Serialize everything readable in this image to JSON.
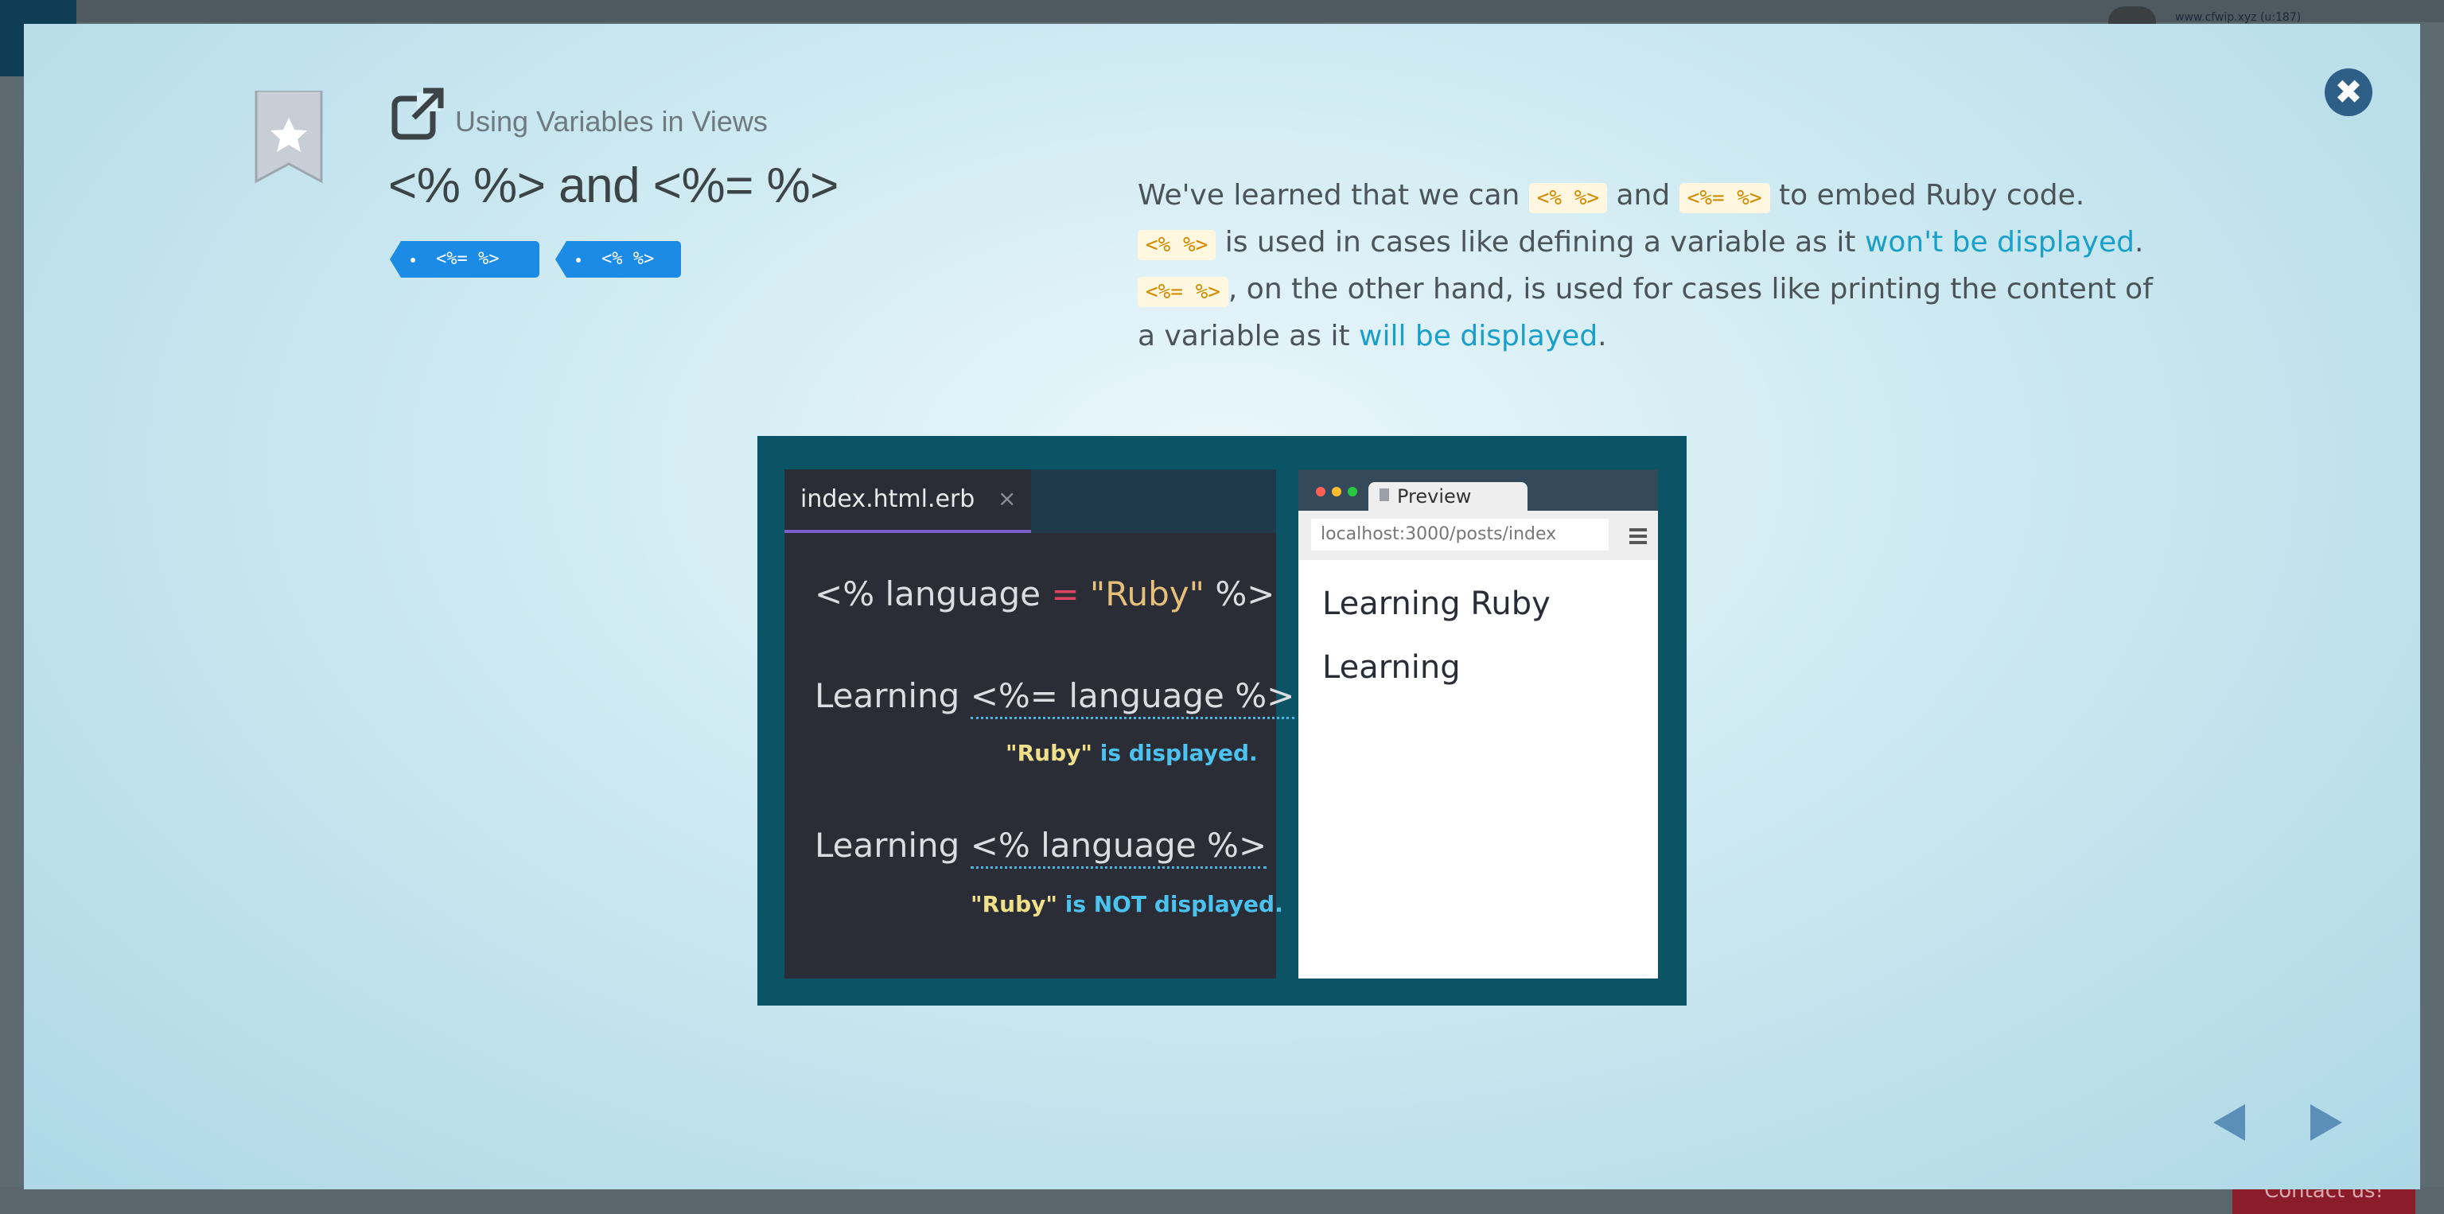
{
  "background": {
    "user_text": "www.cfwip.xyz (u:187)",
    "contact_label": "Contact us!"
  },
  "modal": {
    "close_icon": "close-icon",
    "lesson_title": "Using Variables in Views",
    "slide_title": "<% %> and <%= %>",
    "tags": [
      {
        "label": "<%= %>"
      },
      {
        "label": "<% %>"
      }
    ],
    "description": {
      "p1_a": "We've learned that we can ",
      "p1_code1": "<% %>",
      "p1_b": " and ",
      "p1_code2": "<%= %>",
      "p1_c": " to embed Ruby code.",
      "p2_code": "<% %>",
      "p2_a": " is used in cases like defining a variable as it ",
      "p2_link": "won't be displayed",
      "p2_b": ".",
      "p3_code": "<%= %>",
      "p3_a": ", on the other hand, is used for cases like printing the content of a variable as it ",
      "p3_link": "will be displayed",
      "p3_b": "."
    },
    "illustration": {
      "editor": {
        "tab_label": "index.html.erb",
        "tab_close": "×",
        "line1_a": "<% language ",
        "line1_eq": "=",
        "line1_str": " \"Ruby\"",
        "line1_b": " %>",
        "line2_a": "Learning ",
        "line2_code": "<%= language %>",
        "note1_q": "\"Ruby\"",
        "note1_rest": " is displayed.",
        "line3_a": "Learning ",
        "line3_code": "<% language %>",
        "note2_q": "\"Ruby\"",
        "note2_rest": " is NOT displayed."
      },
      "browser": {
        "tab_label": "Preview",
        "url": "localhost:3000/posts/index",
        "line1": "Learning Ruby",
        "line2": "Learning"
      }
    },
    "nav": {
      "prev_icon": "triangle-left-icon",
      "next_icon": "triangle-right-icon"
    }
  },
  "colors": {
    "accent_blue": "#1b8be6",
    "link": "#199fc8",
    "close_button": "#2d5f87",
    "illustration_bg": "#0b5465"
  }
}
